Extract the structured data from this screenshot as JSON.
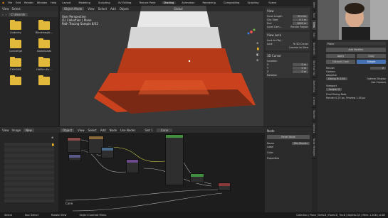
{
  "topbar": {
    "menus": [
      "File",
      "Edit",
      "Render",
      "Window",
      "Help"
    ],
    "workspaces": [
      "Layout",
      "Modeling",
      "Sculpting",
      "UV Editing",
      "Texture Paint",
      "Shading",
      "Animation",
      "Rendering",
      "Compositing",
      "Scripting"
    ],
    "active_workspace": "Shading",
    "scene": "Scene"
  },
  "filebrowser": {
    "menus": [
      "View",
      "Select"
    ],
    "path": "C:\\Users\\k",
    "folders": [
      "Audacity",
      "Blackmagic...",
      "Concierge",
      "Downloads",
      "FXHOME",
      "HitFilm Ex...",
      "",
      ""
    ]
  },
  "viewport": {
    "mode": "Object Mode",
    "menus": [
      "View",
      "Select",
      "Add",
      "Object"
    ],
    "info": [
      "User Perspective",
      "(1) Collection | Plane",
      "Path Tracing Sample 8/32"
    ],
    "shading": "Global"
  },
  "npanel": {
    "view_title": "View",
    "focal_label": "Focal Length",
    "focal_value": "50 mm",
    "clip_start_label": "Clip Start",
    "clip_start_value": "0.1 m",
    "end_label": "End",
    "end_value": "1000 m",
    "local_camera": "Local Cam...",
    "render_region": "Render Region",
    "view_lock": "View Lock",
    "lock_to_obj": "Lock to Obj...",
    "lock": "Lock",
    "to_3d_cursor": "To 3D Cursor",
    "camera_to_view": "Camera to View",
    "cursor_title": "3D Cursor",
    "location_label": "Location",
    "loc_x": "0 m",
    "loc_y": "0 m",
    "loc_z": "0 m",
    "rotation_label": "Rotation"
  },
  "tabs": [
    "Item",
    "Tool",
    "View",
    "Edit",
    "BlenderKit",
    "Shortcut VUr",
    "Sketchfab",
    "Create",
    "Shader",
    "Options",
    "Node Wrangler"
  ],
  "props": {
    "object": "Plane",
    "add_modifier": "Add Modifier",
    "apply": "Apply",
    "copy": "Copy",
    "catmull": "Catmull-Clark",
    "simple": "Simple",
    "render_label": "Render",
    "render_value": "0",
    "options": "Options",
    "adaptive": "Adaptive",
    "dicing": "Dicing R: 0.50",
    "optimal": "Optimal Display",
    "use_creases": "Use Creases",
    "viewport_label": "Viewport",
    "viewport_value": "Levels: 3",
    "final_scale": "Final Dicing Rate",
    "final_values": "Render 0.25 px, Preview 1.00 px"
  },
  "nodeeditor": {
    "mode": "Object",
    "menus": [
      "View",
      "Select",
      "Add",
      "Node"
    ],
    "use_nodes": "Use Nodes",
    "slot": "Slot 1",
    "material": "Cone",
    "frame_label": "Cone"
  },
  "nodepanel": {
    "title": "Node",
    "reset": "Reset Node",
    "name_label": "Name",
    "name_value": "Mix Shader",
    "label_label": "Label",
    "color": "Color",
    "properties": "Properties"
  },
  "leftpane": {
    "menus": [
      "View",
      "Image"
    ],
    "new": "New"
  },
  "statusbar": {
    "items": [
      "Select",
      "Box Select",
      "Rotate View",
      "Object Context Menu",
      "Collection | Plane | Verts:8 | Faces:4 | Tris:8 | Objects:1/3 | Mem: 1.2GB | v2.83"
    ]
  },
  "colors": {
    "accent": "#4772b3",
    "folder": "#e2b93b",
    "cone": "#c9421d"
  }
}
